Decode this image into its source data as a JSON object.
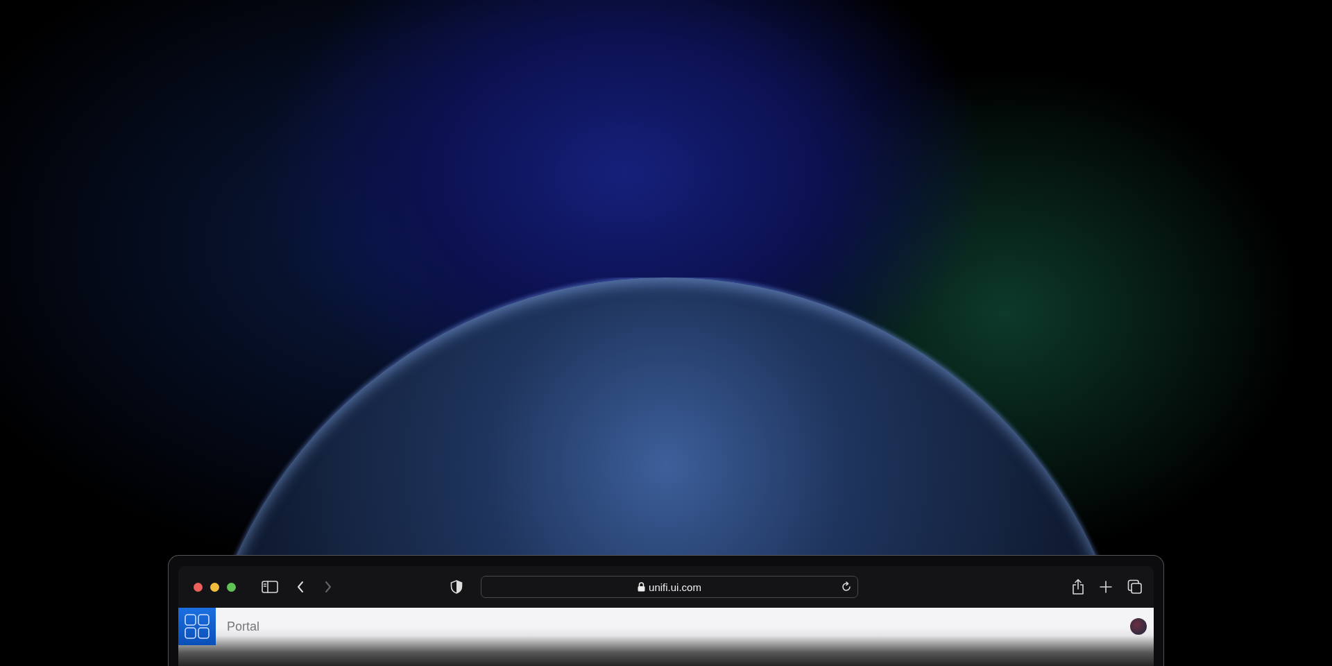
{
  "browser": {
    "url": "unifi.ui.com",
    "back_disabled": false,
    "forward_disabled": true
  },
  "page_header": {
    "title": "Portal"
  }
}
